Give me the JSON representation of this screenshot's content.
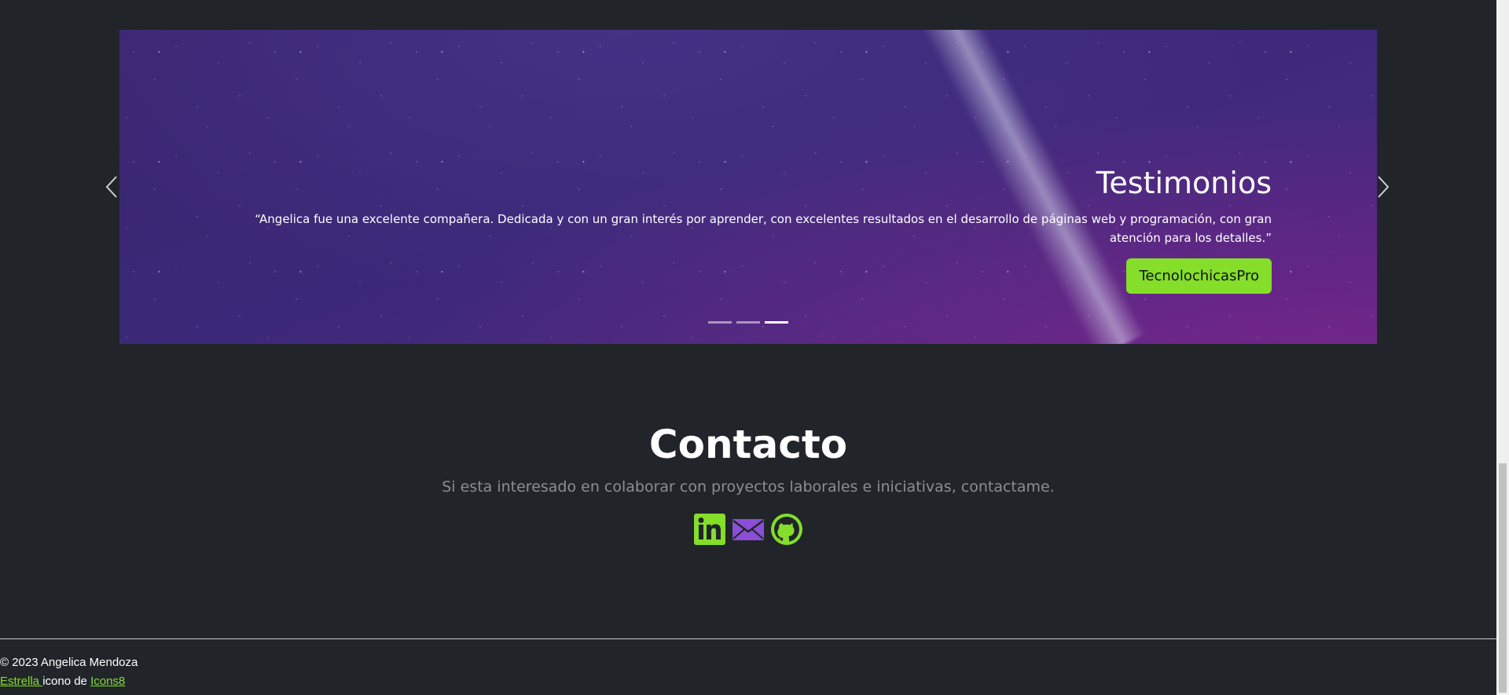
{
  "carousel": {
    "title": "Testimonios",
    "quote": "“Angelica fue una excelente compañera. Dedicada y con un gran interés por aprender, con excelentes resultados en el desarrollo de páginas web y programación, con gran atención para los detalles.”",
    "button_label": "TecnolochicasPro",
    "slide_count": 3,
    "active_slide": 3
  },
  "contact": {
    "title": "Contacto",
    "subtitle": "Si esta interesado en colaborar con proyectos laborales e iniciativas, contactame.",
    "icons": [
      "linkedin-icon",
      "email-icon",
      "github-icon"
    ]
  },
  "footer": {
    "copyright": "© 2023 Angelica Mendoza",
    "credit_link1": "Estrella ",
    "credit_text": "icono de ",
    "credit_link2": "Icons8"
  },
  "colors": {
    "background": "#212529",
    "accent_green": "#84de2a",
    "accent_purple": "#8a4fd6"
  }
}
